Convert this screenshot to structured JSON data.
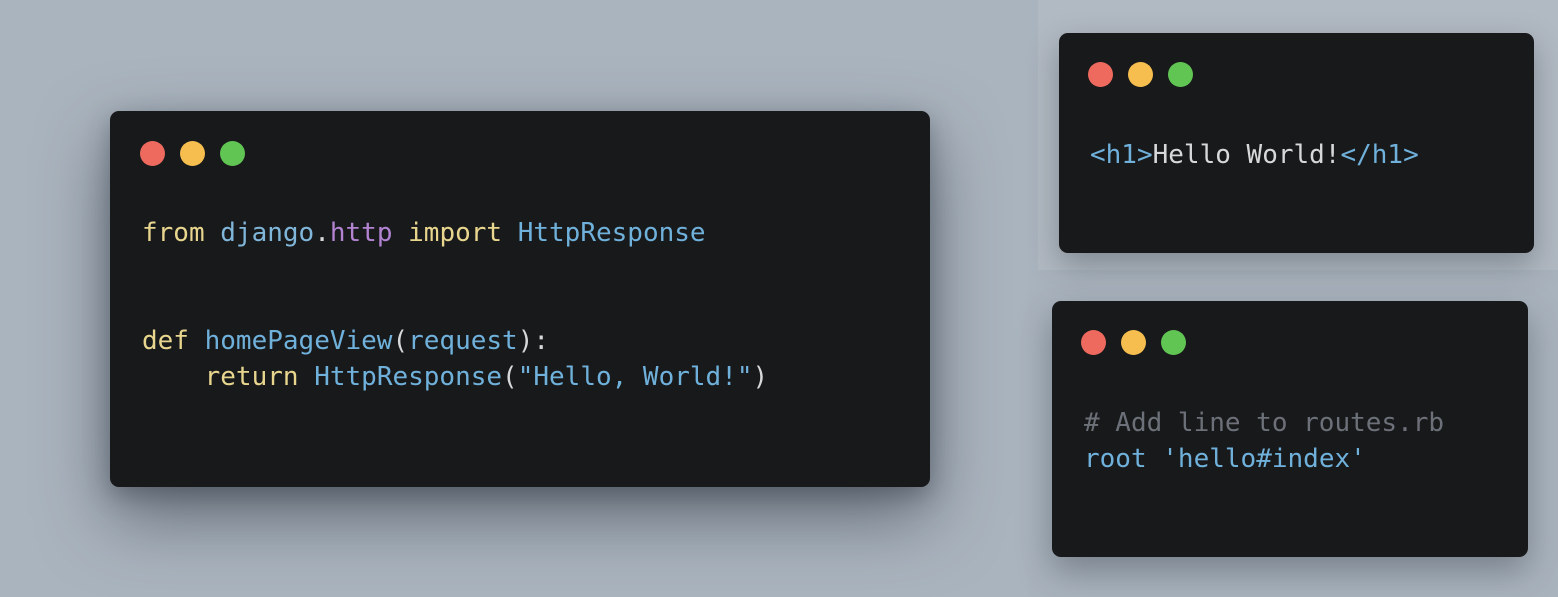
{
  "colors": {
    "background": "#aab4be",
    "window_bg": "#18191b",
    "dot_close": "#ee6a5f",
    "dot_minimize": "#f6be4f",
    "dot_maximize": "#61c554",
    "keyword": "#e8d68e",
    "identifier": "#6fb1db",
    "attribute": "#b283d1",
    "comment": "#6c7078",
    "plain": "#d6d8da"
  },
  "python_window": {
    "line1": {
      "kw_from": "from",
      "module": "django",
      "dot": ".",
      "attr": "http",
      "kw_import": "import",
      "class": "HttpResponse"
    },
    "line2": {
      "kw_def": "def",
      "func": "homePageView",
      "open": "(",
      "param": "request",
      "close": "):"
    },
    "line3": {
      "indent": "    ",
      "kw_return": "return",
      "class": "HttpResponse",
      "open": "(",
      "string": "\"Hello, World!\"",
      "close": ")"
    }
  },
  "html_window": {
    "open_tag": "<h1>",
    "text": "Hello World!",
    "close_tag": "</h1>"
  },
  "ruby_window": {
    "comment": "# Add line to routes.rb",
    "kw_root": "root",
    "string": "'hello#index'"
  }
}
